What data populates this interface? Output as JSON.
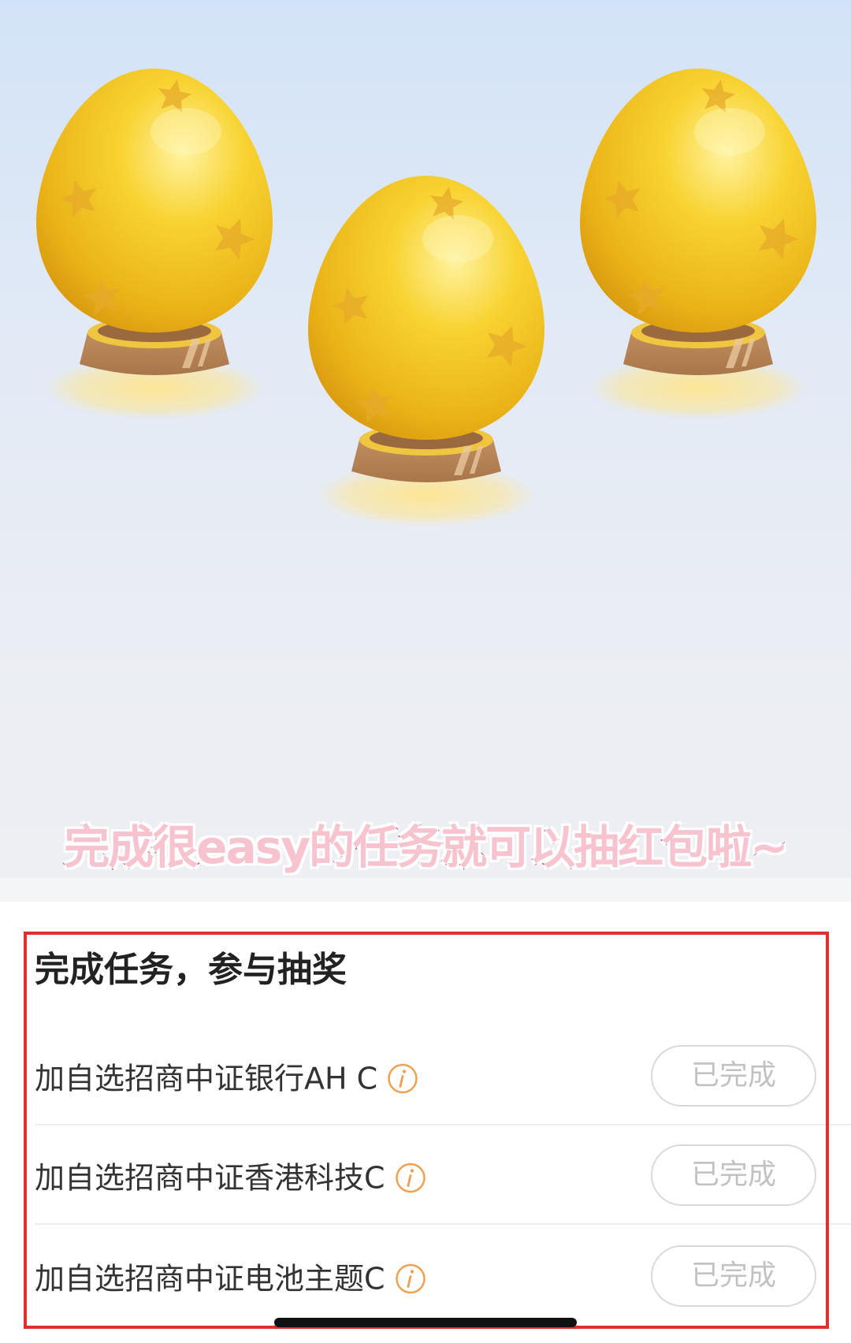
{
  "hero": {
    "caption": "完成很easy的任务就可以抽红包啦~",
    "illustration": "three-golden-eggs-on-pedestals"
  },
  "panel": {
    "title": "完成任务，参与抽奖",
    "tasks": [
      {
        "label": "加自选招商中证银行AH C",
        "icon": "info-icon",
        "button": "已完成"
      },
      {
        "label": "加自选招商中证香港科技C",
        "icon": "info-icon",
        "button": "已完成"
      },
      {
        "label": "加自选招商中证电池主题C",
        "icon": "info-icon",
        "button": "已完成"
      }
    ]
  },
  "colors": {
    "accent_orange": "#f0a050",
    "highlight_red": "#df2f2f",
    "caption_pink": "#f7c3cf",
    "caption_stroke": "#c9607c",
    "egg_gold": "#f5c518",
    "pedestal_brown": "#b7845a"
  }
}
